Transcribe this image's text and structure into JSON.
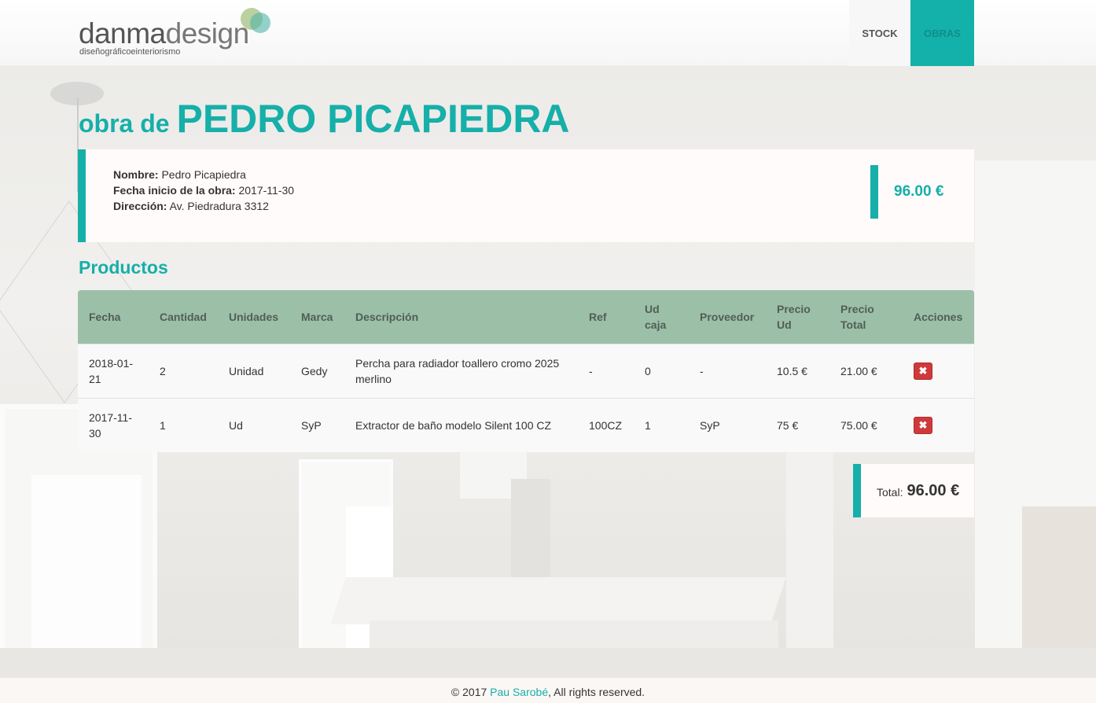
{
  "brand": {
    "name_part1": "danma",
    "name_part2": "design",
    "tagline": "diseñográficoeinteriorismo"
  },
  "nav": {
    "items": [
      {
        "label": "STOCK"
      },
      {
        "label": "OBRAS"
      }
    ]
  },
  "page": {
    "title_prefix": "obra de",
    "title_name": "PEDRO PICAPIEDRA"
  },
  "info": {
    "nombre_label": "Nombre:",
    "nombre_value": "Pedro Picapiedra",
    "fecha_label": "Fecha inicio de la obra:",
    "fecha_value": "2017-11-30",
    "direccion_label": "Dirección:",
    "direccion_value": "Av. Piedradura 3312",
    "total": "96.00 €"
  },
  "productos": {
    "section_title": "Productos",
    "headers": [
      "Fecha",
      "Cantidad",
      "Unidades",
      "Marca",
      "Descripción",
      "Ref",
      "Ud caja",
      "Proveedor",
      "Precio Ud",
      "Precio Total",
      "Acciones"
    ],
    "rows": [
      {
        "fecha": "2018-01-21",
        "cantidad": "2",
        "unidades": "Unidad",
        "marca": "Gedy",
        "descripcion": "Percha para radiador toallero cromo 2025 merlino",
        "ref": "-",
        "ud_caja": "0",
        "proveedor": "-",
        "precio_ud": "10.5 €",
        "precio_total": "21.00 €",
        "accion_icon": "✖"
      },
      {
        "fecha": "2017-11-30",
        "cantidad": "1",
        "unidades": "Ud",
        "marca": "SyP",
        "descripcion": "Extractor de baño modelo Silent 100 CZ",
        "ref": "100CZ",
        "ud_caja": "1",
        "proveedor": "SyP",
        "precio_ud": "75 €",
        "precio_total": "75.00 €",
        "accion_icon": "✖"
      }
    ]
  },
  "total": {
    "label": "Total:",
    "value": "96.00 €"
  },
  "footer": {
    "prefix": "© 2017",
    "author": "Pau Sarobé",
    "suffix": ", All rights reserved."
  },
  "colors": {
    "accent": "#16afa9",
    "table_header": "#9cbfa8",
    "delete_button": "#d0393a"
  },
  "icons": {
    "delete": "times-icon",
    "logo_circles": "logo-circles-icon"
  }
}
